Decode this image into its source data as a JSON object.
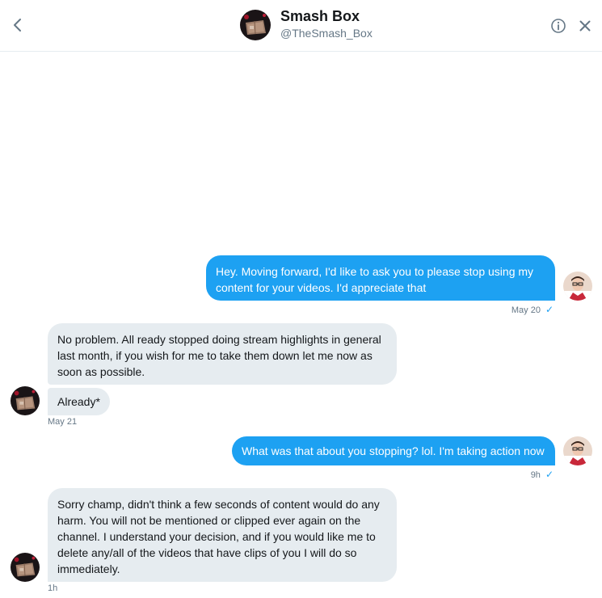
{
  "header": {
    "name": "Smash Box",
    "handle": "@TheSmash_Box",
    "icons": {
      "back": "chevron-left-icon",
      "info": "info-icon",
      "close": "close-icon"
    }
  },
  "messages": [
    {
      "id": "m1",
      "direction": "sent",
      "text": "Hey. Moving forward, I'd like to ask you to please stop using my content for your videos. I'd appreciate that",
      "time": "May 20",
      "read": true
    },
    {
      "id": "m2",
      "direction": "received",
      "text": "No problem. All ready stopped doing stream highlights in general last month, if you wish for me to take them down let me now as soon as possible."
    },
    {
      "id": "m3",
      "direction": "received",
      "text": "Already*",
      "time": "May 21"
    },
    {
      "id": "m4",
      "direction": "sent",
      "text": "What was that about you stopping? lol. I'm taking action now",
      "time": "9h",
      "read": true
    },
    {
      "id": "m5",
      "direction": "received",
      "text": "Sorry champ, didn't think a few seconds of content would do any harm. You will not be mentioned or clipped ever again on the channel. I understand your decision, and if you would like me to delete any/all of the videos that have clips of you I will do so immediately.",
      "time": "1h"
    }
  ],
  "colors": {
    "sent_bubble": "#1da1f2",
    "received_bubble": "#e6ecf0",
    "meta_text": "#657786",
    "read_check": "#1da1f2"
  },
  "read_mark": "✓"
}
